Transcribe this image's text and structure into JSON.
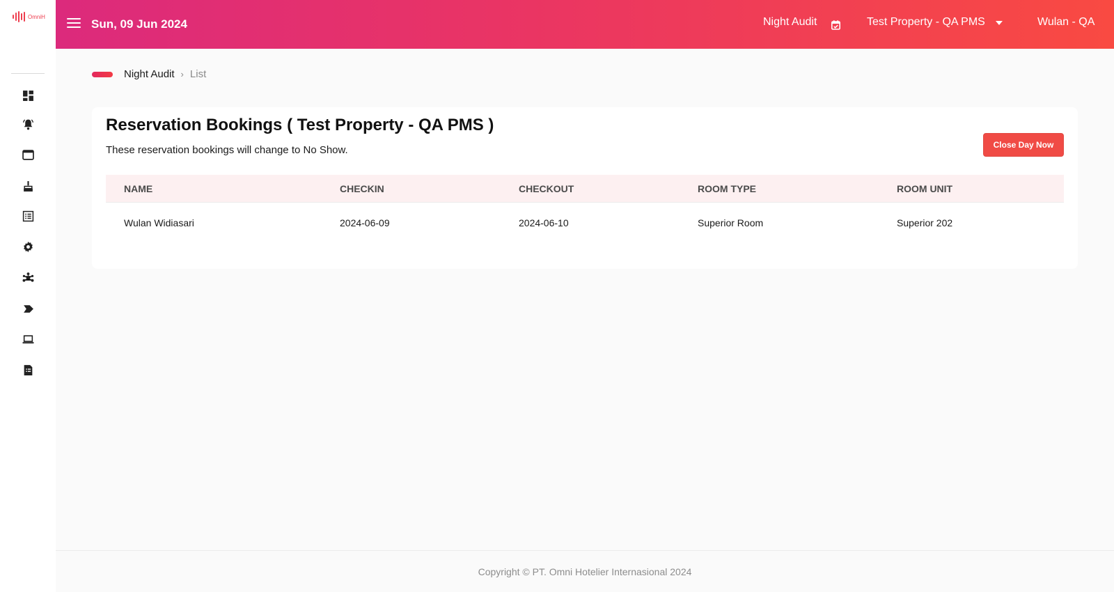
{
  "brand": {
    "logo_text": "OmniH",
    "accent": "#ee3e4f"
  },
  "header": {
    "date": "Sun, 09 Jun 2024",
    "night_audit_label": "Night Audit",
    "property": "Test Property - QA PMS",
    "user": "Wulan - QA",
    "gradient": [
      "#dc2a7c",
      "#f94a42"
    ]
  },
  "sidebar": {
    "icons": [
      "dashboard-icon",
      "bell-alert-icon",
      "browser-window-icon",
      "housekeeping-icon",
      "list-icon",
      "settings-icon",
      "network-icon",
      "tag-arrow-icon",
      "laptop-icon",
      "report-icon"
    ]
  },
  "breadcrumb": {
    "level1": "Night Audit",
    "separator": "›",
    "level2": "List"
  },
  "card": {
    "title": "Reservation Bookings ( Test Property - QA PMS )",
    "subtitle": "These reservation bookings will change to No Show.",
    "close_button": "Close Day Now"
  },
  "table": {
    "headers": [
      "NAME",
      "CHECKIN",
      "CHECKOUT",
      "ROOM TYPE",
      "ROOM UNIT"
    ],
    "rows": [
      [
        "Wulan Widiasari",
        "2024-06-09",
        "2024-06-10",
        "Superior Room",
        "Superior 202"
      ]
    ]
  },
  "footer": {
    "copyright": "Copyright © PT. Omni Hotelier Internasional 2024"
  }
}
